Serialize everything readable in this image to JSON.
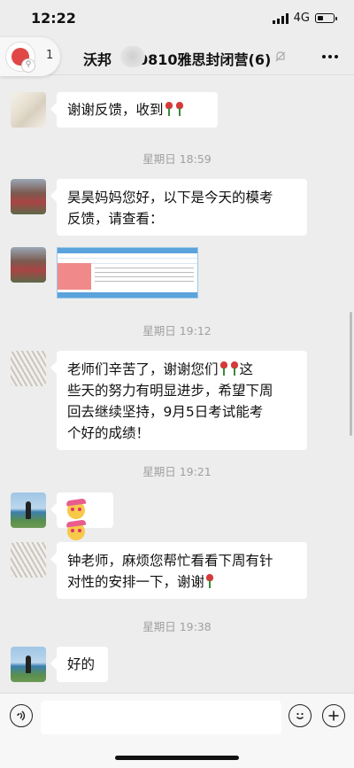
{
  "status_bar": {
    "time": "12:22",
    "network": "4G"
  },
  "nav": {
    "back_count": "1",
    "title": "沃邦…0810雅思封闭营(6)",
    "title_left": "沃邦",
    "title_right": "0810雅思封闭营(6)"
  },
  "messages": [
    {
      "type": "text",
      "avatar": "ink-painting",
      "text": "谢谢反馈，收到"
    },
    {
      "type": "timestamp",
      "text": "星期日 18:59"
    },
    {
      "type": "text",
      "avatar": "building",
      "line1": "昊昊妈妈您好，以下是今天的模考",
      "line2": "反馈，请查看："
    },
    {
      "type": "image",
      "avatar": "building",
      "description": ""
    },
    {
      "type": "timestamp",
      "text": "星期日 19:12"
    },
    {
      "type": "text",
      "avatar": "grass-sketch",
      "line1a": "老师们辛苦了，谢谢您们",
      "line1b": "这",
      "line2": "些天的努力有明显进步，希望下周",
      "line3": "回去继续坚持，9月5日考试能考",
      "line4": "个好的成绩！"
    },
    {
      "type": "timestamp",
      "text": "星期日 19:21"
    },
    {
      "type": "emoji",
      "avatar": "seaside-person"
    },
    {
      "type": "text",
      "avatar": "grass-sketch",
      "line1": "钟老师，麻烦您帮忙看看下周有针",
      "line2": "对性的安排一下，谢谢"
    },
    {
      "type": "timestamp",
      "text": "星期日 19:38"
    },
    {
      "type": "text",
      "avatar": "seaside-person",
      "text": "好的"
    }
  ],
  "input_bar": {
    "voice_icon": "voice-icon",
    "emoji_icon": "emoji-icon",
    "plus_icon": "plus-icon",
    "placeholder": ""
  }
}
